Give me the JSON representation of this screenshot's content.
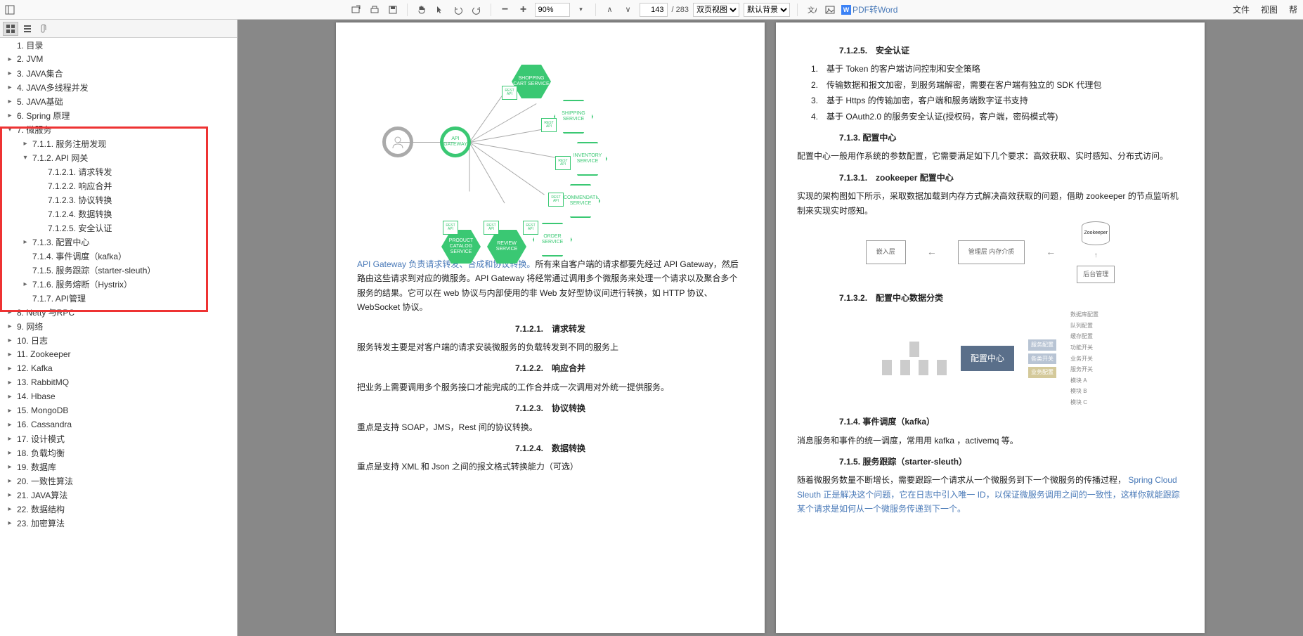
{
  "toolbar": {
    "zoom": "90%",
    "page_current": "143",
    "page_total": "/ 283",
    "view_mode": "双页视图",
    "background": "默认背景",
    "pdf_to_word": "PDF转Word",
    "menu_file": "文件",
    "menu_view": "视图",
    "menu_help": "帮"
  },
  "outline": [
    {
      "lvl": 0,
      "tgl": "",
      "label": "1. 目录"
    },
    {
      "lvl": 0,
      "tgl": "▸",
      "label": "2. JVM"
    },
    {
      "lvl": 0,
      "tgl": "▸",
      "label": "3. JAVA集合"
    },
    {
      "lvl": 0,
      "tgl": "▸",
      "label": "4. JAVA多线程并发"
    },
    {
      "lvl": 0,
      "tgl": "▸",
      "label": "5. JAVA基础"
    },
    {
      "lvl": 0,
      "tgl": "▸",
      "label": "6. Spring 原理"
    },
    {
      "lvl": 0,
      "tgl": "▾",
      "label": "7. 微服务"
    },
    {
      "lvl": 1,
      "tgl": "▸",
      "label": "7.1.1. 服务注册发现"
    },
    {
      "lvl": 1,
      "tgl": "▾",
      "label": "7.1.2. API 网关"
    },
    {
      "lvl": 2,
      "tgl": "",
      "label": "7.1.2.1. 请求转发"
    },
    {
      "lvl": 2,
      "tgl": "",
      "label": "7.1.2.2. 响应合并"
    },
    {
      "lvl": 2,
      "tgl": "",
      "label": "7.1.2.3. 协议转换"
    },
    {
      "lvl": 2,
      "tgl": "",
      "label": "7.1.2.4. 数据转换"
    },
    {
      "lvl": 2,
      "tgl": "",
      "label": "7.1.2.5. 安全认证"
    },
    {
      "lvl": 1,
      "tgl": "▸",
      "label": "7.1.3. 配置中心"
    },
    {
      "lvl": 1,
      "tgl": "",
      "label": "7.1.4. 事件调度（kafka）"
    },
    {
      "lvl": 1,
      "tgl": "",
      "label": "7.1.5. 服务跟踪（starter-sleuth）"
    },
    {
      "lvl": 1,
      "tgl": "▸",
      "label": "7.1.6. 服务熔断（Hystrix）"
    },
    {
      "lvl": 1,
      "tgl": "",
      "label": "7.1.7. API管理"
    },
    {
      "lvl": 0,
      "tgl": "▸",
      "label": "8. Netty 与RPC"
    },
    {
      "lvl": 0,
      "tgl": "▸",
      "label": "9. 网络"
    },
    {
      "lvl": 0,
      "tgl": "▸",
      "label": "10. 日志"
    },
    {
      "lvl": 0,
      "tgl": "▸",
      "label": "11. Zookeeper"
    },
    {
      "lvl": 0,
      "tgl": "▸",
      "label": "12. Kafka"
    },
    {
      "lvl": 0,
      "tgl": "▸",
      "label": "13. RabbitMQ"
    },
    {
      "lvl": 0,
      "tgl": "▸",
      "label": "14. Hbase"
    },
    {
      "lvl": 0,
      "tgl": "▸",
      "label": "15. MongoDB"
    },
    {
      "lvl": 0,
      "tgl": "▸",
      "label": "16. Cassandra"
    },
    {
      "lvl": 0,
      "tgl": "▸",
      "label": "17. 设计模式"
    },
    {
      "lvl": 0,
      "tgl": "▸",
      "label": "18. 负载均衡"
    },
    {
      "lvl": 0,
      "tgl": "▸",
      "label": "19. 数据库"
    },
    {
      "lvl": 0,
      "tgl": "▸",
      "label": "20. 一致性算法"
    },
    {
      "lvl": 0,
      "tgl": "▸",
      "label": "21. JAVA算法"
    },
    {
      "lvl": 0,
      "tgl": "▸",
      "label": "22. 数据结构"
    },
    {
      "lvl": 0,
      "tgl": "▸",
      "label": "23. 加密算法"
    }
  ],
  "p1": {
    "gateway_link": "API Gateway 负责请求转发、合成和协议转换。",
    "gateway_rest": "所有来自客户端的请求都要先经过 API Gateway，然后路由这些请求到对应的微服务。API Gateway 将经常通过调用多个微服务来处理一个请求以及聚合多个服务的结果。它可以在 web 协议与内部使用的非 Web 友好型协议间进行转换，如 HTTP 协议、WebSocket 协议。",
    "h1": "7.1.2.1.　请求转发",
    "t1": "服务转发主要是对客户端的请求安装微服务的负载转发到不同的服务上",
    "h2": "7.1.2.2.　响应合并",
    "t2": "把业务上需要调用多个服务接口才能完成的工作合并成一次调用对外统一提供服务。",
    "h3": "7.1.2.3.　协议转换",
    "t3": "重点是支持 SOAP，JMS，Rest 间的协议转换。",
    "h4": "7.1.2.4.　数据转换",
    "t4": "重点是支持 XML 和 Json 之间的报文格式转换能力（可选）",
    "hex": {
      "gateway": "API GATEWAY",
      "cart": "SHOPPING CART SERVICE",
      "ship": "SHIPPING SERVICE",
      "inv": "INVENTORY SERVICE",
      "rec": "RECOMMENDATION SERVICE",
      "order": "ORDER SERVICE",
      "review": "REVIEW SERVICE",
      "catalog": "PRODUCT CATALOG SERVICE",
      "rest": "REST API"
    }
  },
  "p2": {
    "h0": "7.1.2.5.　安全认证",
    "li1": "1.　基于 Token 的客户端访问控制和安全策略",
    "li2": "2.　传输数据和报文加密，到服务端解密，需要在客户端有独立的 SDK 代理包",
    "li3": "3.　基于 Https 的传输加密，客户端和服务端数字证书支持",
    "li4": "4.　基于 OAuth2.0 的服务安全认证(授权码，客户端，密码模式等)",
    "h1": "7.1.3. 配置中心",
    "t1": "配置中心一般用作系统的参数配置，它需要满足如下几个要求：高效获取、实时感知、分布式访问。",
    "h2": "7.1.3.1.　zookeeper 配置中心",
    "t2": "实现的架构图如下所示，采取数据加载到内存方式解决高效获取的问题，借助 zookeeper 的节点监听机制来实现实时感知。",
    "h3": "7.1.3.2.　配置中心数据分类",
    "h4": "7.1.4. 事件调度（kafka）",
    "t4": "消息服务和事件的统一调度，常用用 kafka ，activemq 等。",
    "h5": "7.1.5. 服务跟踪（starter-sleuth）",
    "t5a": "随着微服务数量不断增长，需要跟踪一个请求从一个微服务到下一个微服务的传播过程， ",
    "t5b": "Spring Cloud Sleuth 正是解决这个问题，它在日志中引入唯一 ID，以保证微服务调用之间的一致性，这样你就能跟踪某个请求是如何从一个微服务传递到下一个。",
    "d2": {
      "b1": "嵌入层",
      "b2": "管理层 内存介质",
      "zk": "Zookeeper",
      "dd": "后台管理"
    },
    "d3": {
      "center": "配置中心",
      "tag1": "服务配置",
      "tag2": "各类开关",
      "tag3": "业务配置",
      "r": [
        "数据库配置",
        "队列配置",
        "缓存配置",
        "功能开关",
        "业务开关",
        "服务开关",
        "模块 A",
        "模块 B",
        "模块 C"
      ]
    }
  }
}
